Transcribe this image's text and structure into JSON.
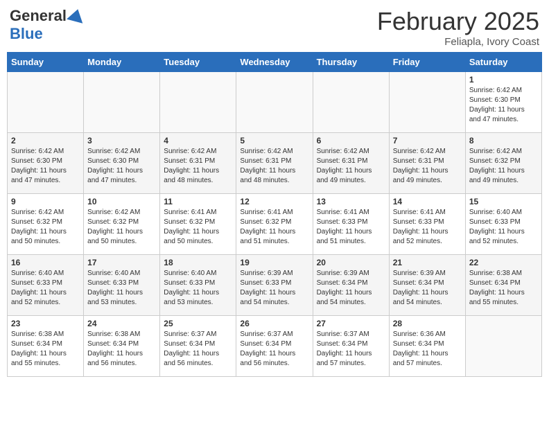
{
  "header": {
    "logo_general": "General",
    "logo_blue": "Blue",
    "month_title": "February 2025",
    "location": "Feliapla, Ivory Coast"
  },
  "calendar": {
    "days_of_week": [
      "Sunday",
      "Monday",
      "Tuesday",
      "Wednesday",
      "Thursday",
      "Friday",
      "Saturday"
    ],
    "weeks": [
      [
        {
          "day": "",
          "info": ""
        },
        {
          "day": "",
          "info": ""
        },
        {
          "day": "",
          "info": ""
        },
        {
          "day": "",
          "info": ""
        },
        {
          "day": "",
          "info": ""
        },
        {
          "day": "",
          "info": ""
        },
        {
          "day": "1",
          "info": "Sunrise: 6:42 AM\nSunset: 6:30 PM\nDaylight: 11 hours and 47 minutes."
        }
      ],
      [
        {
          "day": "2",
          "info": "Sunrise: 6:42 AM\nSunset: 6:30 PM\nDaylight: 11 hours and 47 minutes."
        },
        {
          "day": "3",
          "info": "Sunrise: 6:42 AM\nSunset: 6:30 PM\nDaylight: 11 hours and 47 minutes."
        },
        {
          "day": "4",
          "info": "Sunrise: 6:42 AM\nSunset: 6:31 PM\nDaylight: 11 hours and 48 minutes."
        },
        {
          "day": "5",
          "info": "Sunrise: 6:42 AM\nSunset: 6:31 PM\nDaylight: 11 hours and 48 minutes."
        },
        {
          "day": "6",
          "info": "Sunrise: 6:42 AM\nSunset: 6:31 PM\nDaylight: 11 hours and 49 minutes."
        },
        {
          "day": "7",
          "info": "Sunrise: 6:42 AM\nSunset: 6:31 PM\nDaylight: 11 hours and 49 minutes."
        },
        {
          "day": "8",
          "info": "Sunrise: 6:42 AM\nSunset: 6:32 PM\nDaylight: 11 hours and 49 minutes."
        }
      ],
      [
        {
          "day": "9",
          "info": "Sunrise: 6:42 AM\nSunset: 6:32 PM\nDaylight: 11 hours and 50 minutes."
        },
        {
          "day": "10",
          "info": "Sunrise: 6:42 AM\nSunset: 6:32 PM\nDaylight: 11 hours and 50 minutes."
        },
        {
          "day": "11",
          "info": "Sunrise: 6:41 AM\nSunset: 6:32 PM\nDaylight: 11 hours and 50 minutes."
        },
        {
          "day": "12",
          "info": "Sunrise: 6:41 AM\nSunset: 6:32 PM\nDaylight: 11 hours and 51 minutes."
        },
        {
          "day": "13",
          "info": "Sunrise: 6:41 AM\nSunset: 6:33 PM\nDaylight: 11 hours and 51 minutes."
        },
        {
          "day": "14",
          "info": "Sunrise: 6:41 AM\nSunset: 6:33 PM\nDaylight: 11 hours and 52 minutes."
        },
        {
          "day": "15",
          "info": "Sunrise: 6:40 AM\nSunset: 6:33 PM\nDaylight: 11 hours and 52 minutes."
        }
      ],
      [
        {
          "day": "16",
          "info": "Sunrise: 6:40 AM\nSunset: 6:33 PM\nDaylight: 11 hours and 52 minutes."
        },
        {
          "day": "17",
          "info": "Sunrise: 6:40 AM\nSunset: 6:33 PM\nDaylight: 11 hours and 53 minutes."
        },
        {
          "day": "18",
          "info": "Sunrise: 6:40 AM\nSunset: 6:33 PM\nDaylight: 11 hours and 53 minutes."
        },
        {
          "day": "19",
          "info": "Sunrise: 6:39 AM\nSunset: 6:33 PM\nDaylight: 11 hours and 54 minutes."
        },
        {
          "day": "20",
          "info": "Sunrise: 6:39 AM\nSunset: 6:34 PM\nDaylight: 11 hours and 54 minutes."
        },
        {
          "day": "21",
          "info": "Sunrise: 6:39 AM\nSunset: 6:34 PM\nDaylight: 11 hours and 54 minutes."
        },
        {
          "day": "22",
          "info": "Sunrise: 6:38 AM\nSunset: 6:34 PM\nDaylight: 11 hours and 55 minutes."
        }
      ],
      [
        {
          "day": "23",
          "info": "Sunrise: 6:38 AM\nSunset: 6:34 PM\nDaylight: 11 hours and 55 minutes."
        },
        {
          "day": "24",
          "info": "Sunrise: 6:38 AM\nSunset: 6:34 PM\nDaylight: 11 hours and 56 minutes."
        },
        {
          "day": "25",
          "info": "Sunrise: 6:37 AM\nSunset: 6:34 PM\nDaylight: 11 hours and 56 minutes."
        },
        {
          "day": "26",
          "info": "Sunrise: 6:37 AM\nSunset: 6:34 PM\nDaylight: 11 hours and 56 minutes."
        },
        {
          "day": "27",
          "info": "Sunrise: 6:37 AM\nSunset: 6:34 PM\nDaylight: 11 hours and 57 minutes."
        },
        {
          "day": "28",
          "info": "Sunrise: 6:36 AM\nSunset: 6:34 PM\nDaylight: 11 hours and 57 minutes."
        },
        {
          "day": "",
          "info": ""
        }
      ]
    ]
  }
}
